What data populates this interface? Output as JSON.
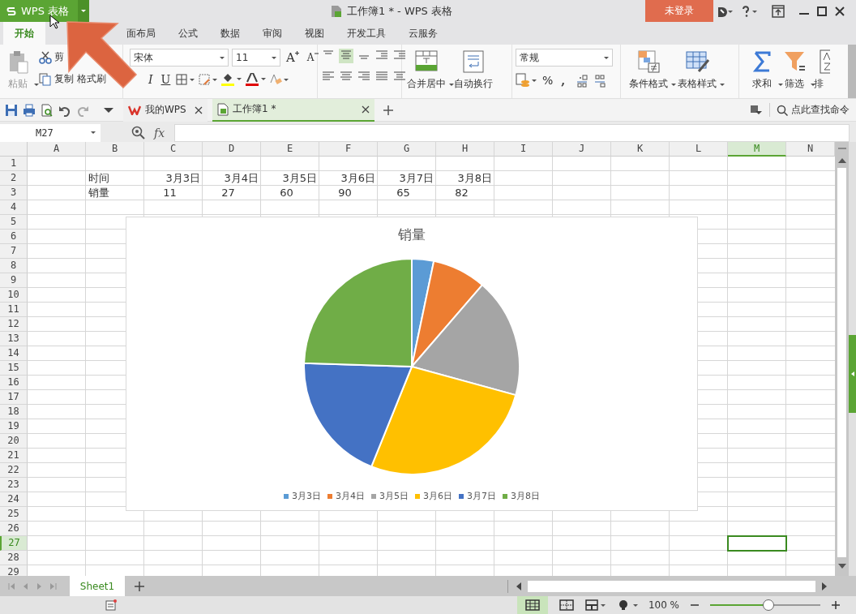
{
  "title_bar": {
    "app_menu": "WPS 表格",
    "title": "工作簿1 * - WPS 表格",
    "login": "未登录"
  },
  "ribbon_tabs": [
    {
      "label": "开始",
      "selected": true
    },
    {
      "label": "面布局",
      "selected": false
    },
    {
      "label": "公式",
      "selected": false
    },
    {
      "label": "数据",
      "selected": false
    },
    {
      "label": "审阅",
      "selected": false
    },
    {
      "label": "视图",
      "selected": false
    },
    {
      "label": "开发工具",
      "selected": false
    },
    {
      "label": "云服务",
      "selected": false
    }
  ],
  "ribbon": {
    "paste": "粘贴",
    "cut": "剪",
    "copy": "复制",
    "format_painter": "格式刷",
    "font_name": "宋体",
    "font_size": "11",
    "grow_font": "A",
    "shrink_font": "A",
    "italic": "I",
    "underline": "U",
    "merge": "合并居中",
    "wrap": "自动换行",
    "number_format": "常规",
    "percent": "%",
    "comma": ",",
    "conditional_format": "条件格式",
    "table_style": "表格样式",
    "sum": "求和",
    "filter": "筛选",
    "sort": "排"
  },
  "doc_tabs": [
    {
      "label": "我的WPS",
      "selected": false
    },
    {
      "label": "工作簿1 *",
      "selected": true
    }
  ],
  "command_search": "点此查找命令",
  "name_box": "M27",
  "formula_label": "fx",
  "sheet": {
    "columns": [
      {
        "label": "A",
        "selected": false
      },
      {
        "label": "B",
        "selected": false
      },
      {
        "label": "C",
        "selected": false
      },
      {
        "label": "D",
        "selected": false
      },
      {
        "label": "E",
        "selected": false
      },
      {
        "label": "F",
        "selected": false
      },
      {
        "label": "G",
        "selected": false
      },
      {
        "label": "H",
        "selected": false
      },
      {
        "label": "I",
        "selected": false
      },
      {
        "label": "J",
        "selected": false
      },
      {
        "label": "K",
        "selected": false
      },
      {
        "label": "L",
        "selected": false
      },
      {
        "label": "M",
        "selected": true
      },
      {
        "label": "N",
        "selected": false
      }
    ],
    "rows": [
      {
        "label": "1",
        "selected": false
      },
      {
        "label": "2",
        "selected": false,
        "cells": {
          "B": "时间",
          "C": "3月3日",
          "D": "3月4日",
          "E": "3月5日",
          "F": "3月6日",
          "G": "3月7日",
          "H": "3月8日"
        }
      },
      {
        "label": "3",
        "selected": false,
        "cells": {
          "B": "销量",
          "C": "11",
          "D": "27",
          "E": "60",
          "F": "90",
          "G": "65",
          "H": "82"
        }
      },
      {
        "label": "4",
        "selected": false
      },
      {
        "label": "5",
        "selected": false
      },
      {
        "label": "6",
        "selected": false
      },
      {
        "label": "7",
        "selected": false
      },
      {
        "label": "8",
        "selected": false
      },
      {
        "label": "9",
        "selected": false
      },
      {
        "label": "10",
        "selected": false
      },
      {
        "label": "11",
        "selected": false
      },
      {
        "label": "12",
        "selected": false
      },
      {
        "label": "13",
        "selected": false
      },
      {
        "label": "14",
        "selected": false
      },
      {
        "label": "15",
        "selected": false
      },
      {
        "label": "16",
        "selected": false
      },
      {
        "label": "17",
        "selected": false
      },
      {
        "label": "18",
        "selected": false
      },
      {
        "label": "19",
        "selected": false
      },
      {
        "label": "20",
        "selected": false
      },
      {
        "label": "21",
        "selected": false
      },
      {
        "label": "22",
        "selected": false
      },
      {
        "label": "23",
        "selected": false
      },
      {
        "label": "24",
        "selected": false
      },
      {
        "label": "25",
        "selected": false
      },
      {
        "label": "26",
        "selected": false
      },
      {
        "label": "27",
        "selected": true
      },
      {
        "label": "28",
        "selected": false
      },
      {
        "label": "29",
        "selected": false
      }
    ],
    "chart": {
      "chart_data": {
        "type": "pie",
        "title": "销量",
        "categories": [
          "3月3日",
          "3月4日",
          "3月5日",
          "3月6日",
          "3月7日",
          "3月8日"
        ],
        "values": [
          3.28,
          8.06,
          17.91,
          26.87,
          19.4,
          24.48
        ],
        "legend": "bottom",
        "colors": [
          "#5b9bd5",
          "#ed7d31",
          "#a5a5a5",
          "#ffc000",
          "#4472c4",
          "#70ad47"
        ]
      }
    }
  },
  "sheet_tabs": [
    {
      "label": "Sheet1",
      "selected": true
    }
  ],
  "status_bar": {
    "zoom": "100 %",
    "zoom_level": {
      "level": 0.52
    }
  }
}
